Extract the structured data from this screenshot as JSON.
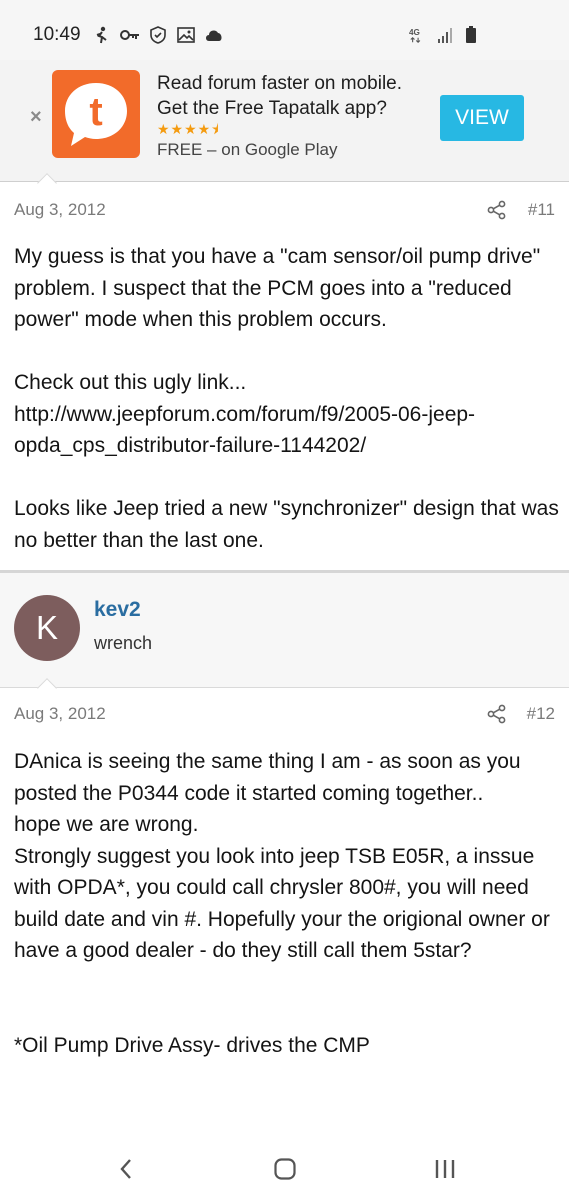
{
  "status_bar": {
    "time": "10:49",
    "left_icons": [
      "runner-icon",
      "key-icon",
      "shield-check-icon",
      "image-icon",
      "cloud-icon"
    ],
    "right_icons": [
      "4g-signal-icon",
      "signal-bars-icon",
      "battery-icon"
    ],
    "network": "4G"
  },
  "banner": {
    "close": "×",
    "logo_letter": "t",
    "line1": "Read forum faster on mobile.",
    "line2": "Get the Free Tapatalk app?",
    "stars": "★★★★⯨",
    "rating": 4.5,
    "store": "FREE – on Google Play",
    "button": "VIEW",
    "colors": {
      "logo": "#f26b2a",
      "button": "#27b8e3",
      "stars": "#f49b10"
    }
  },
  "posts": [
    {
      "date": "Aug 3, 2012",
      "number": "#11",
      "body": "My guess is that you have a \"cam sensor/oil pump drive\" problem. I suspect that the PCM goes into a \"reduced power\" mode when this problem occurs.\n\nCheck out this ugly link...\nhttp://www.jeepforum.com/forum/f9/2005-06-jeep-opda_cps_distributor-failure-1144202/\n\nLooks like Jeep tried a new \"synchronizer\" design that was no better than the last one."
    },
    {
      "date": "Aug 3, 2012",
      "number": "#12",
      "author": {
        "initial": "K",
        "name": "kev2",
        "title": "wrench"
      },
      "body": "DAnica is seeing the same thing I am - as soon as you posted the P0344 code it started coming together..\nhope we are wrong.\nStrongly suggest you look into jeep TSB E05R, a inssue with OPDA*, you could call chrysler 800#, you will need build date and vin #. Hopefully your the origional owner or have a good dealer - do they still call them 5star?\n\n\n*Oil Pump Drive Assy- drives the CMP"
    }
  ],
  "nav": {
    "back": "‹",
    "home": "○",
    "recents": "|||"
  }
}
